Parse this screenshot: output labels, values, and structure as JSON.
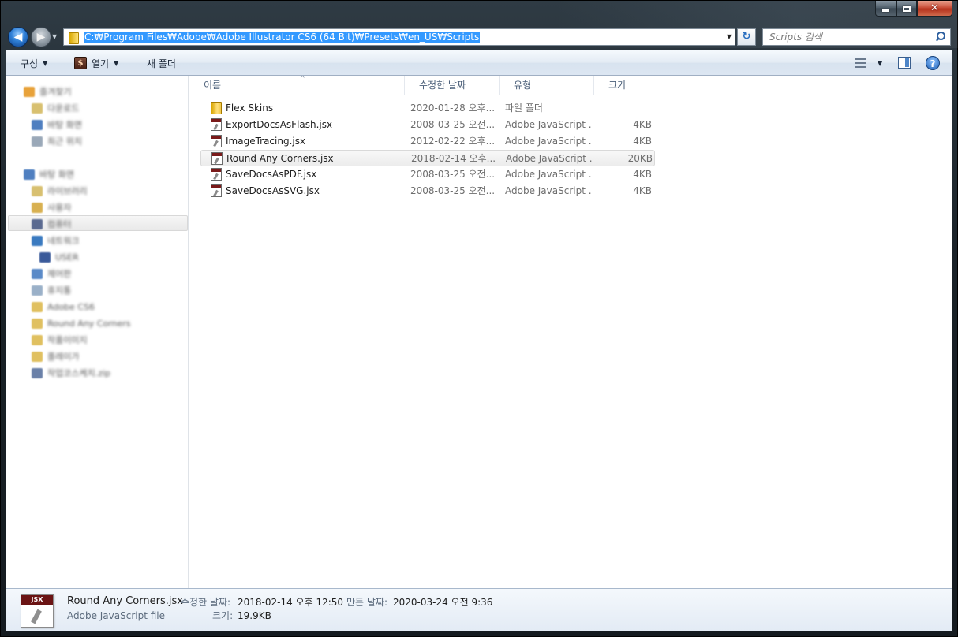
{
  "window": {
    "caption": {
      "minimize_icon": "minimize-icon",
      "maximize_icon": "maximize-icon",
      "close_icon": "close-icon",
      "close_glyph": "✕"
    }
  },
  "navigation": {
    "back_glyph": "◀",
    "forward_glyph": "▶",
    "address": "C:₩Program Files₩Adobe₩Adobe Illustrator CS6 (64 Bit)₩Presets₩en_US₩Scripts",
    "refresh_glyph": "↻",
    "search_placeholder": "Scripts 검색"
  },
  "toolbar": {
    "organize_label": "구성",
    "open_label": "열기",
    "open_icon_glyph": "$",
    "new_folder_label": "새 폴더",
    "help_glyph": "?"
  },
  "sidebar": {
    "items": [
      {
        "label": "즐겨찾기",
        "indent": 0,
        "color": "#e8a23a"
      },
      {
        "label": "다운로드",
        "indent": 1,
        "color": "#d8c070"
      },
      {
        "label": "바탕 화면",
        "indent": 1,
        "color": "#4f7fc0"
      },
      {
        "label": "최근 위치",
        "indent": 1,
        "color": "#9aa8b8"
      },
      {
        "label": "바탕 화면",
        "indent": 0,
        "color": "#4f7fc0"
      },
      {
        "label": "라이브러리",
        "indent": 1,
        "color": "#d8c070"
      },
      {
        "label": "사용자",
        "indent": 1,
        "color": "#d8b050"
      },
      {
        "label": "컴퓨터",
        "indent": 1,
        "color": "#5a6a90"
      },
      {
        "label": "네트워크",
        "indent": 1,
        "color": "#3a7ac0"
      },
      {
        "label": "USER",
        "indent": 2,
        "color": "#3a5a9a"
      },
      {
        "label": "제어판",
        "indent": 1,
        "color": "#5a8ac8"
      },
      {
        "label": "휴지통",
        "indent": 1,
        "color": "#9ab0c8"
      },
      {
        "label": "Adobe CS6",
        "indent": 1,
        "color": "#e0c060"
      },
      {
        "label": "Round Any Corners",
        "indent": 1,
        "color": "#e0c060"
      },
      {
        "label": "작품이미지",
        "indent": 1,
        "color": "#e0c060"
      },
      {
        "label": "플레이가",
        "indent": 1,
        "color": "#e0c060"
      },
      {
        "label": "작업코스케치.zip",
        "indent": 1,
        "color": "#6a80a8"
      }
    ]
  },
  "columns": {
    "name": "이름",
    "modified": "수정한 날짜",
    "type": "유형",
    "size": "크기"
  },
  "files": [
    {
      "name": "Flex Skins",
      "modified": "2020-01-28 오후...",
      "type": "파일 폴더",
      "size": "",
      "kind": "folder"
    },
    {
      "name": "ExportDocsAsFlash.jsx",
      "modified": "2008-03-25 오전...",
      "type": "Adobe JavaScript ...",
      "size": "4KB",
      "kind": "jsx"
    },
    {
      "name": "ImageTracing.jsx",
      "modified": "2012-02-22 오후...",
      "type": "Adobe JavaScript ...",
      "size": "4KB",
      "kind": "jsx"
    },
    {
      "name": "Round Any Corners.jsx",
      "modified": "2018-02-14 오후...",
      "type": "Adobe JavaScript ...",
      "size": "20KB",
      "kind": "jsx",
      "selected": true
    },
    {
      "name": "SaveDocsAsPDF.jsx",
      "modified": "2008-03-25 오전...",
      "type": "Adobe JavaScript ...",
      "size": "4KB",
      "kind": "jsx"
    },
    {
      "name": "SaveDocsAsSVG.jsx",
      "modified": "2008-03-25 오전...",
      "type": "Adobe JavaScript ...",
      "size": "4KB",
      "kind": "jsx"
    }
  ],
  "details": {
    "icon_band": "JSX",
    "file_name": "Round Any Corners.jsx",
    "file_type": "Adobe JavaScript file",
    "modified_label": "수정한 날짜:",
    "modified_value": "2018-02-14 오후 12:50",
    "created_label": "만든 날짜:",
    "created_value": "2020-03-24 오전 9:36",
    "size_label": "크기:",
    "size_value": "19.9KB"
  }
}
